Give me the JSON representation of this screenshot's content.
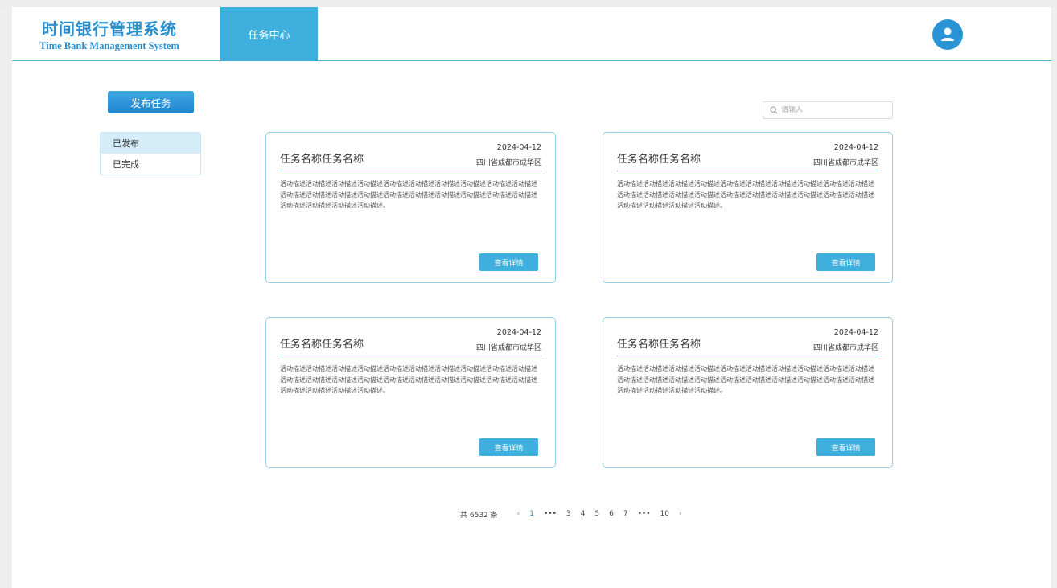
{
  "header": {
    "brand_cn": "时间银行管理系统",
    "brand_en": "Time Bank Management System",
    "nav_tab": "任务中心"
  },
  "sidebar": {
    "publish_label": "发布任务",
    "menu": [
      {
        "label": "已发布",
        "active": true
      },
      {
        "label": "已完成",
        "active": false
      }
    ]
  },
  "search": {
    "placeholder": "请输入",
    "icon": "search-icon"
  },
  "cards": [
    {
      "title": "任务名称任务名称",
      "date": "2024-04-12",
      "address": "四川省成都市成华区",
      "description": "活动描述活动描述活动描述活动描述活动描述活动描述活动描述活动描述活动描述活动描述活动描述活动描述活动描述活动描述活动描述活动描述活动描述活动描述活动描述活动描述活动描述活动描述活动描述活动描述。",
      "button": "查看详情"
    },
    {
      "title": "任务名称任务名称",
      "date": "2024-04-12",
      "address": "四川省成都市成华区",
      "description": "活动描述活动描述活动描述活动描述活动描述活动描述活动描述活动描述活动描述活动描述活动描述活动描述活动描述活动描述活动描述活动描述活动描述活动描述活动描述活动描述活动描述活动描述活动描述活动描述。",
      "button": "查看详情"
    },
    {
      "title": "任务名称任务名称",
      "date": "2024-04-12",
      "address": "四川省成都市成华区",
      "description": "活动描述活动描述活动描述活动描述活动描述活动描述活动描述活动描述活动描述活动描述活动描述活动描述活动描述活动描述活动描述活动描述活动描述活动描述活动描述活动描述活动描述活动描述活动描述活动描述。",
      "button": "查看详情"
    },
    {
      "title": "任务名称任务名称",
      "date": "2024-04-12",
      "address": "四川省成都市成华区",
      "description": "活动描述活动描述活动描述活动描述活动描述活动描述活动描述活动描述活动描述活动描述活动描述活动描述活动描述活动描述活动描述活动描述活动描述活动描述活动描述活动描述活动描述活动描述活动描述活动描述。",
      "button": "查看详情"
    }
  ],
  "pagination": {
    "total": "共 6532 条",
    "prev": "‹",
    "next": "›",
    "pages": [
      "1",
      "•••",
      "3",
      "4",
      "5",
      "6",
      "7",
      "•••",
      "10"
    ],
    "active": "1"
  },
  "colors": {
    "accent": "#3fb0dd",
    "brand": "#2a8fcf",
    "border": "#8ed0ea"
  }
}
